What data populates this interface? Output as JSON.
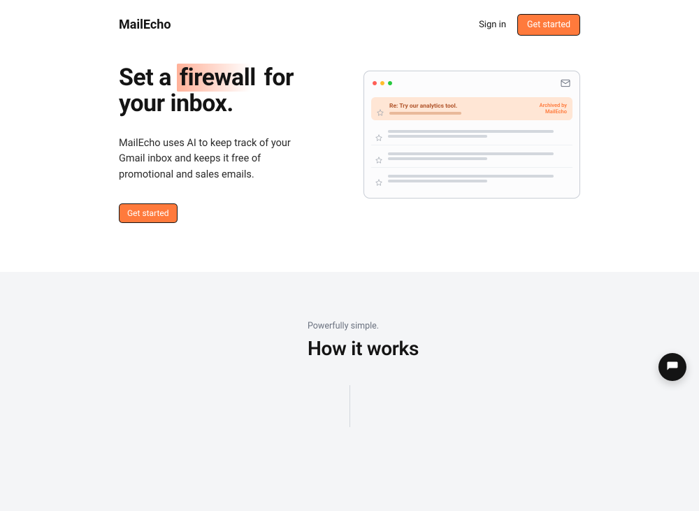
{
  "brand": "MailEcho",
  "nav": {
    "signin": "Sign in",
    "get_started": "Get started"
  },
  "hero": {
    "title_pre": "Set a ",
    "title_highlight": "firewall",
    "title_post": " for your inbox.",
    "subtitle": "MailEcho uses AI to keep track of your Gmail inbox and keeps it free of promotional and sales emails.",
    "cta": "Get started"
  },
  "mock": {
    "email_subject": "Re: Try our analytics tool.",
    "badge_line1": "Archived by",
    "badge_line2": "MailEcho"
  },
  "section2": {
    "kicker": "Powerfully simple.",
    "title": "How it works"
  }
}
